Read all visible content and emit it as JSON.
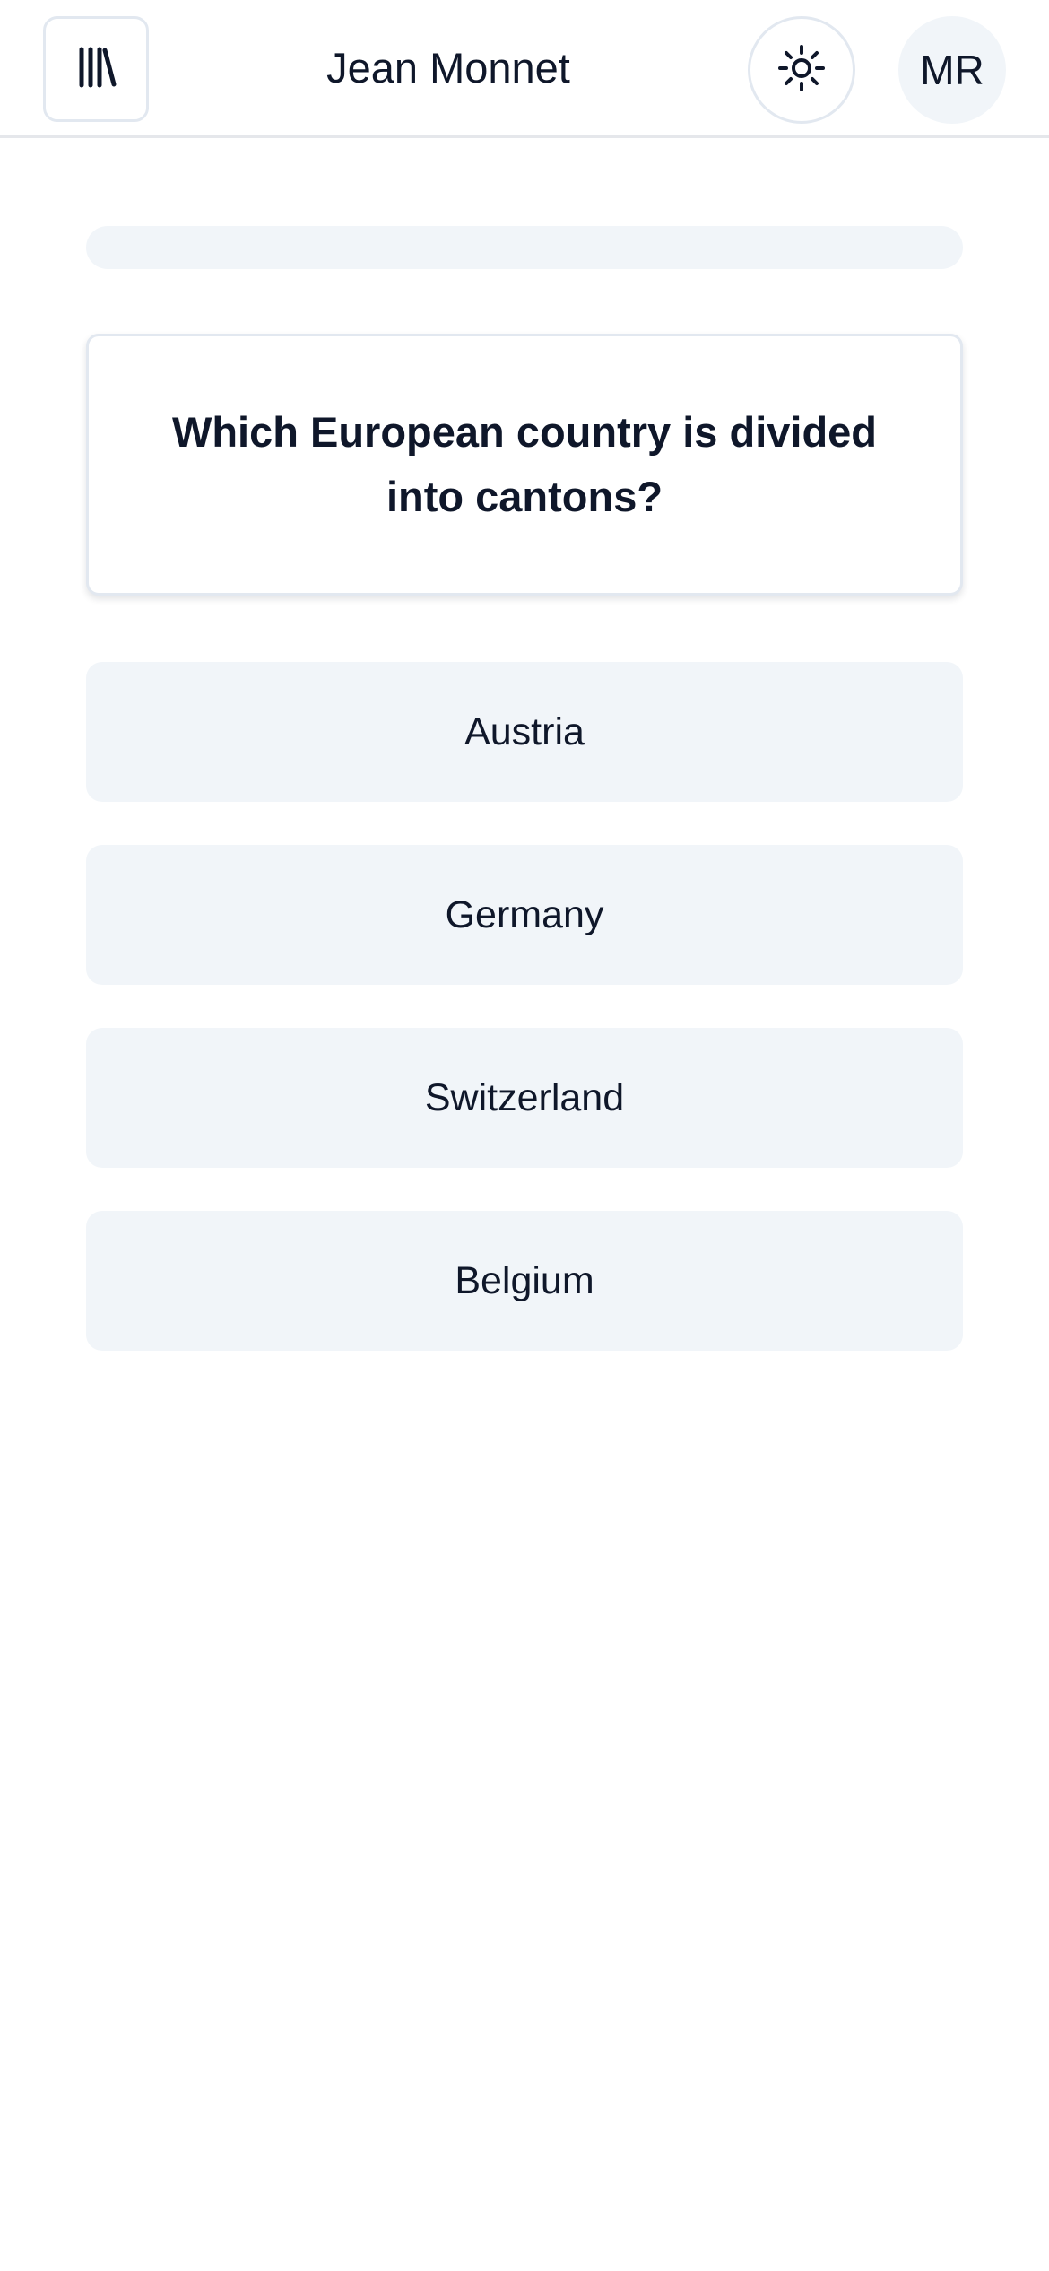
{
  "header": {
    "library_icon": "library-icon",
    "title": "Jean Monnet",
    "theme_icon": "sun-icon",
    "avatar_initials": "MR"
  },
  "progress": {
    "value": 0
  },
  "question": {
    "text": "Which European country is divided into cantons?"
  },
  "answers": [
    {
      "label": "Austria"
    },
    {
      "label": "Germany"
    },
    {
      "label": "Switzerland"
    },
    {
      "label": "Belgium"
    }
  ],
  "colors": {
    "text": "#0f172a",
    "surface": "#f1f5f9",
    "border": "#e2e8f0"
  }
}
